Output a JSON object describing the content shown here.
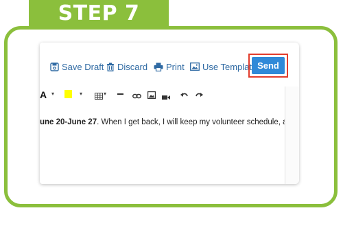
{
  "banner": {
    "title": "STEP 7"
  },
  "toolbar": {
    "save_draft": "Save Draft",
    "discard": "Discard",
    "print": "Print",
    "use_template": "Use Template",
    "send": "Send"
  },
  "format_toolbar": {
    "font_glyph": "A",
    "highlight_color": "#ffff00",
    "icons": [
      "font-icon",
      "highlight-icon",
      "table-icon",
      "horizontal-rule-icon",
      "link-icon",
      "image-icon",
      "video-icon",
      "undo-icon",
      "redo-icon"
    ]
  },
  "editor": {
    "bold_text": "une 20-June 27",
    "text": ". When I get back, I will keep my volunteer schedule, as"
  },
  "colors": {
    "accent_green": "#8bbf3c",
    "send_blue": "#2f89d8",
    "highlight_red": "#e23c2c",
    "link_blue": "#2f6aa3"
  }
}
